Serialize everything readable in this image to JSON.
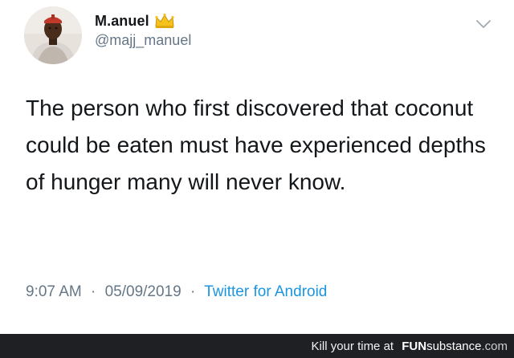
{
  "tweet": {
    "author": {
      "display_name": "M.anuel",
      "handle": "@majj_manuel"
    },
    "text": "The person who first discovered that coconut could be eaten must have experienced depths of hunger many will never know.",
    "time": "9:07 AM",
    "date": "05/09/2019",
    "separator": "·",
    "source": "Twitter for Android",
    "icons": {
      "badge": "crown-icon",
      "menu": "chevron-down-icon"
    },
    "colors": {
      "text": "#14171a",
      "secondary": "#657786",
      "link": "#1b95e0"
    }
  },
  "watermark": {
    "prefix": "Kill your time at",
    "brand_bold": "FUN",
    "brand_light": "substance",
    "domain": ".com"
  }
}
